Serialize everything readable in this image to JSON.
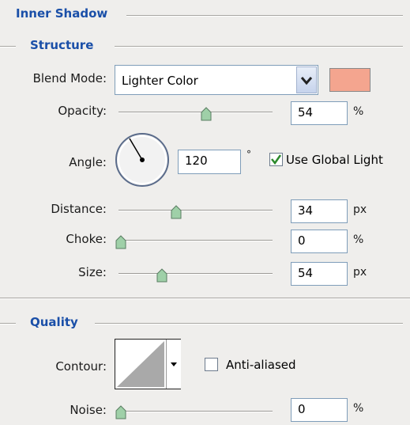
{
  "inner_shadow": {
    "title": "Inner Shadow",
    "structure": {
      "title": "Structure",
      "blend_mode": {
        "label": "Blend Mode:",
        "value": "Lighter Color",
        "color_swatch": "#f4a58f"
      },
      "opacity": {
        "label": "Opacity:",
        "value": "54",
        "unit": "%",
        "level_percent": 54
      },
      "angle": {
        "label": "Angle:",
        "value": "120",
        "unit": "°",
        "use_global_light_label": "Use Global Light",
        "use_global_light_checked": true
      },
      "distance": {
        "label": "Distance:",
        "value": "34",
        "unit": "px",
        "level_fraction": 0.34
      },
      "choke": {
        "label": "Choke:",
        "value": "0",
        "unit": "%",
        "level_percent": 0
      },
      "size": {
        "label": "Size:",
        "value": "54",
        "unit": "px",
        "level_fraction": 0.27
      }
    },
    "quality": {
      "title": "Quality",
      "contour": {
        "label": "Contour:",
        "anti_aliased_label": "Anti-aliased",
        "anti_aliased_checked": false
      },
      "noise": {
        "label": "Noise:",
        "value": "0",
        "unit": "%",
        "level_percent": 0
      }
    }
  },
  "colors": {
    "header_blue": "#1a4fa8",
    "check_green": "#2c8a2c",
    "thumb_green": "#9fd0a8"
  },
  "icons": {
    "dropdown": "chevron-down-icon",
    "angle_dial": "angle-dial-icon",
    "checkmark": "checkmark-icon"
  }
}
